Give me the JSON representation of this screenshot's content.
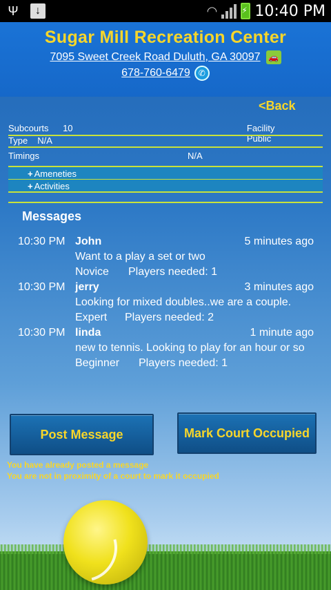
{
  "status_bar": {
    "time": "10:40 PM"
  },
  "header": {
    "title": "Sugar Mill Recreation Center",
    "address": "7095 Sweet Creek Road Duluth, GA 30097",
    "phone": "678-760-6479"
  },
  "back_label": "<Back",
  "details": {
    "subcourts_label": "Subcourts",
    "subcourts_value": "10",
    "facility_label": "Facility",
    "facility_value": "Public",
    "type_label": "Type",
    "type_value": "N/A",
    "timings_label": "Timings",
    "timings_value": "N/A",
    "amenities_label": "Ameneties",
    "activities_label": "Activities"
  },
  "messages": {
    "title": "Messages",
    "items": [
      {
        "time": "10:30 PM",
        "name": "John",
        "ago": "5 minutes ago",
        "text": "Want to a play a set or two",
        "level": "Novice",
        "players": "Players needed: 1"
      },
      {
        "time": "10:30 PM",
        "name": "jerry",
        "ago": "3 minutes ago",
        "text": "Looking for mixed doubles..we are a couple.",
        "level": "Expert",
        "players": "Players needed: 2"
      },
      {
        "time": "10:30 PM",
        "name": "linda",
        "ago": "1 minute ago",
        "text": "new to tennis. Looking to play for an hour or so",
        "level": "Beginner",
        "players": "Players needed: 1"
      }
    ]
  },
  "buttons": {
    "post_message": "Post Message",
    "mark_court": "Mark Court Occupied"
  },
  "notices": {
    "posted": "You have already posted a message",
    "proximity": "You are not in proximity of a court to mark it occupied"
  },
  "colors": {
    "accent": "#f7d62a",
    "divider": "#c8e23a",
    "header_bg": "#1a73d6"
  }
}
